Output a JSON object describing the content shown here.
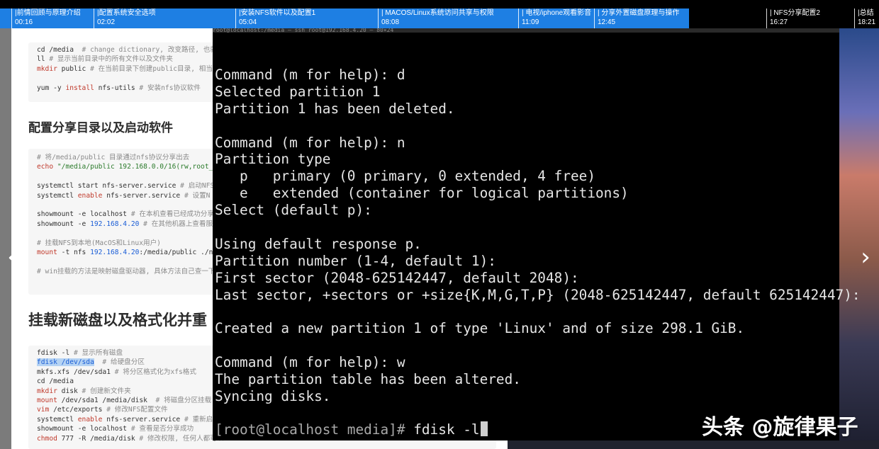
{
  "chapters": [
    {
      "title": "|前情回顾与原理介绍",
      "time": "00:16"
    },
    {
      "title": "|配置系统安全选项",
      "time": "02:02"
    },
    {
      "title": "|安装NFS软件以及配置1",
      "time": "05:04"
    },
    {
      "title": "| MACOS/Linux系统访问共享与权限",
      "time": "08:08"
    },
    {
      "title": "| 电视/iphone观看影音",
      "time": "11:09"
    },
    {
      "title": "| 分享外置磁盘原理与操作",
      "time": "12:45"
    },
    {
      "title": "| NFS分享配置2",
      "time": "16:27"
    },
    {
      "title": "|总结",
      "time": "18:21"
    }
  ],
  "terminal": {
    "title": "root@localhost:/media — ssh root@192.168.4.20 — 80×24",
    "lines": [
      "Command (m for help): d",
      "Selected partition 1",
      "Partition 1 has been deleted.",
      "",
      "Command (m for help): n",
      "Partition type",
      "   p   primary (0 primary, 0 extended, 4 free)",
      "   e   extended (container for logical partitions)",
      "Select (default p):",
      "",
      "Using default response p.",
      "Partition number (1-4, default 1):",
      "First sector (2048-625142447, default 2048):",
      "Last sector, +sectors or +size{K,M,G,T,P} (2048-625142447, default 625142447):",
      "",
      "Created a new partition 1 of type 'Linux' and of size 298.1 GiB.",
      "",
      "Command (m for help): w",
      "The partition table has been altered.",
      "Syncing disks."
    ],
    "prompt": "[root@localhost media]# ",
    "command": "fdisk -l"
  },
  "doc": {
    "heading_config": "配置分享目录以及启动软件",
    "heading_mount": "挂载新磁盘以及格式化并重",
    "block1": [
      {
        "code": "cd /media",
        "comment": "  # change dictionary, 改变路径, 也就"
      },
      {
        "code": "ll",
        "comment": " # 显示当前目录中的所有文件以及文件夹"
      },
      {
        "code_kw": "mkdir",
        "code": " public",
        "comment": " # 在当前目录下创建public目录, 相当"
      },
      {
        "code": "",
        "comment": ""
      },
      {
        "code": "yum -y ",
        "code_kw2": "install",
        "code_tail": " nfs-utils",
        "comment": " # 安装nfs协议软件"
      }
    ],
    "block2": [
      {
        "comment": "# 将/media/public 目录通过nfs协议分享出去"
      },
      {
        "code_kw": "echo",
        "str": " \"/media/public 192.168.0.0/16(rw,root_"
      },
      {
        "code": ""
      },
      {
        "code": "systemctl start nfs-server.service",
        "comment": " # 启动NFS"
      },
      {
        "code": "systemctl ",
        "code_kw2": "enable",
        "code_tail": " nfs-server.service",
        "comment": " # 设置N"
      },
      {
        "code": ""
      },
      {
        "code": "showmount -e localhost",
        "comment": " # 在本机查看已经成功分享"
      },
      {
        "code": "showmount -e ",
        "num": "192.168.4.20",
        "comment": " # 在其他机器上查看服"
      },
      {
        "code": ""
      },
      {
        "comment": "# 挂载NFS到本地(MacOS和Linux用户)"
      },
      {
        "code_kw": "mount",
        "code": " -t nfs ",
        "num": "192.168.4.20",
        "code_tail": ":/media/public ./n"
      },
      {
        "code": ""
      },
      {
        "comment": "# win挂载的方法是映射磁盘驱动器, 具体方法自己查一下"
      }
    ],
    "block3": [
      {
        "code": "fdisk -l",
        "comment": " # 显示所有磁盘"
      },
      {
        "sel": "fdisk /dev/sda",
        "comment": "  # 给硬盘分区"
      },
      {
        "code": "mkfs.xfs /dev/sda1",
        "comment": " # 将分区格式化为xfs格式"
      },
      {
        "code": "cd /media"
      },
      {
        "code_kw": "mkdir",
        "code": " disk",
        "comment": " # 创建新文件夹"
      },
      {
        "code_kw": "mount",
        "code": " /dev/sda1 /media/disk",
        "comment": "  # 将磁盘分区挂载"
      },
      {
        "code_kw": "vim",
        "code": " /etc/exports",
        "comment": " # 修改NFS配置文件"
      },
      {
        "code": "systemctl ",
        "code_kw2": "enable",
        "code_tail": " nfs-server.service",
        "comment": " # 重新启"
      },
      {
        "code": "showmount -e localhost",
        "comment": " # 查看是否分享成功"
      },
      {
        "code_kw": "chmod",
        "code": " 777 -R /media/disk",
        "comment": " # 修改权限, 任何人都可以"
      }
    ]
  },
  "nav": {
    "prev": "‹",
    "next": "›"
  },
  "watermark": "头条 @旋律果子"
}
